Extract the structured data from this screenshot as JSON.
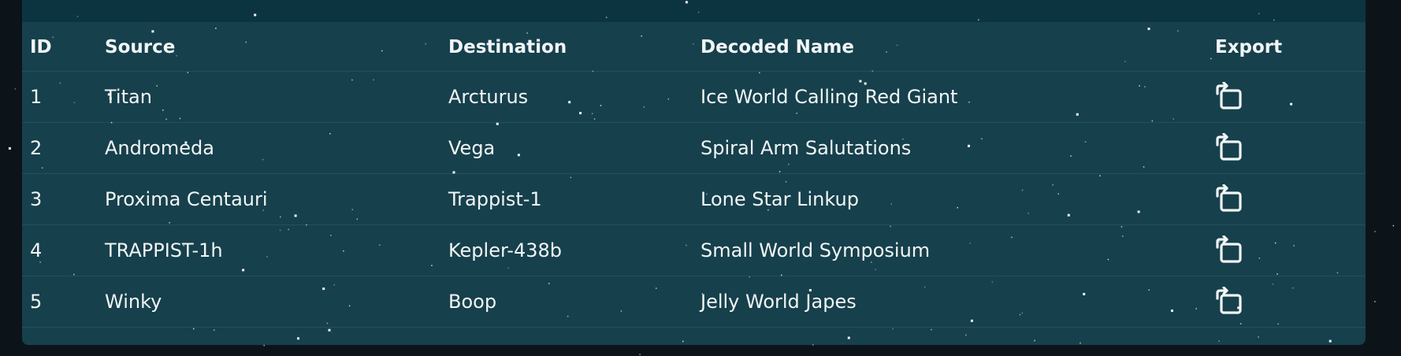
{
  "table": {
    "headers": {
      "id": "ID",
      "source": "Source",
      "destination": "Destination",
      "decoded_name": "Decoded Name",
      "export": "Export"
    },
    "rows": [
      {
        "id": "1",
        "source": "Titan",
        "destination": "Arcturus",
        "decoded_name": "Ice World Calling Red Giant"
      },
      {
        "id": "2",
        "source": "Andromeda",
        "destination": "Vega",
        "decoded_name": "Spiral Arm Salutations"
      },
      {
        "id": "3",
        "source": "Proxima Centauri",
        "destination": "Trappist-1",
        "decoded_name": "Lone Star Linkup"
      },
      {
        "id": "4",
        "source": "TRAPPIST-1h",
        "destination": "Kepler-438b",
        "decoded_name": "Small World Symposium"
      },
      {
        "id": "5",
        "source": "Winky",
        "destination": "Boop",
        "decoded_name": "Jelly World Japes"
      }
    ],
    "export_icon": "export-icon"
  },
  "colors": {
    "page_background": "#0d1419",
    "panel_background": "#16404c",
    "panel_topbar": "#0c3440",
    "row_divider": "#244f5b",
    "text": "#f2f5f6"
  }
}
